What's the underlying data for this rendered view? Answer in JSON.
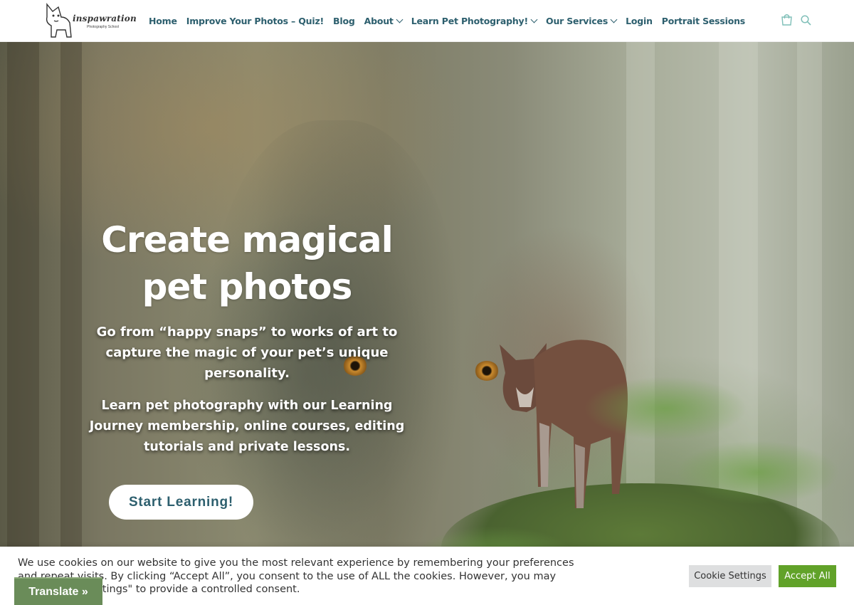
{
  "header": {
    "logo_text": "inspawration",
    "logo_subtext": "Photography School",
    "nav": [
      {
        "label": "Home",
        "dropdown": false
      },
      {
        "label": "Improve Your Photos – Quiz!",
        "dropdown": false
      },
      {
        "label": "Blog",
        "dropdown": false
      },
      {
        "label": "About",
        "dropdown": true
      },
      {
        "label": "Learn Pet Photography!",
        "dropdown": true
      },
      {
        "label": "Our Services",
        "dropdown": true
      },
      {
        "label": "Login",
        "dropdown": false
      },
      {
        "label": "Portrait Sessions",
        "dropdown": false
      }
    ],
    "icons": [
      "cart-icon",
      "search-icon"
    ]
  },
  "hero": {
    "title_line1": "Create magical",
    "title_line2": "pet photos",
    "subtitle1": "Go from “happy snaps” to works of art to capture the magic of your pet’s unique personality.",
    "subtitle2": "Learn pet photography with our Learning Journey membership, online courses, editing tutorials and private lessons.",
    "cta_label": "Start Learning!"
  },
  "cookie": {
    "text": "We use cookies on our website to give you the most relevant experience by remembering your preferences and repeat visits. By clicking “Accept All”, you consent to the use of ALL the cookies. However, you may visit \"Cookie Settings\" to provide a controlled consent.",
    "settings_label": "Cookie Settings",
    "accept_label": "Accept All"
  },
  "translate_label": "Translate »",
  "colors": {
    "nav_text": "#2d5f6e",
    "accent_green": "#61a229",
    "translate_bg": "#6a8c59",
    "icon_teal": "#7fbfb8"
  }
}
